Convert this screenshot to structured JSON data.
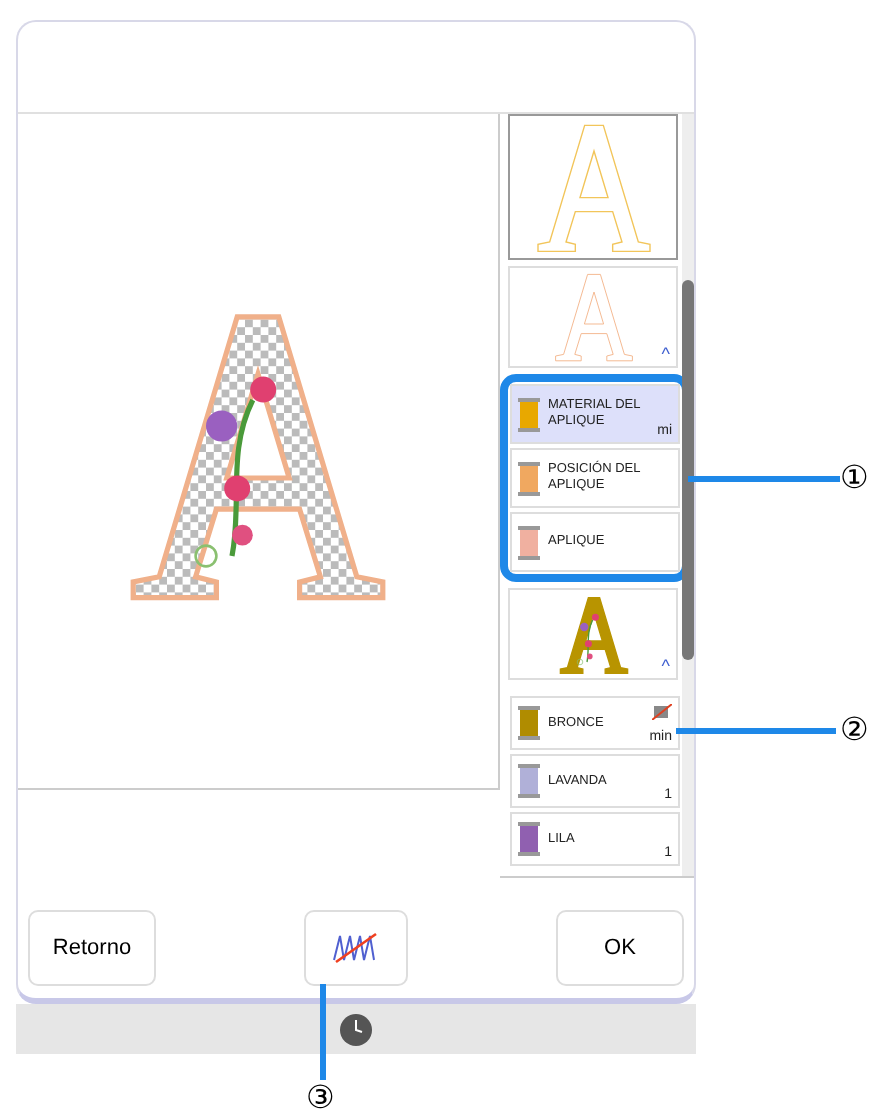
{
  "preview_list": [
    {
      "kind": "outline",
      "color": "#f2c55a",
      "selected": true
    },
    {
      "kind": "outline",
      "color": "#f4b78e",
      "selected": false,
      "caret": "^"
    },
    {
      "kind": "colors",
      "threads": [
        {
          "name": "MATERIAL DEL APLIQUE",
          "color": "#e8a800",
          "count": "mi",
          "selected": true,
          "skip": false
        },
        {
          "name": "POSICIÓN DEL APLIQUE",
          "color": "#f0a860",
          "selected": false,
          "skip": false
        },
        {
          "name": "APLIQUE",
          "color": "#f0b0a0",
          "selected": false,
          "skip": false
        }
      ]
    },
    {
      "kind": "stitched",
      "color": "#b89400",
      "selected": false,
      "caret": "^"
    },
    {
      "kind": "colors",
      "threads": [
        {
          "name": "BRONCE",
          "color": "#b08c00",
          "count": "min",
          "selected": false,
          "skip": true
        },
        {
          "name": "LAVANDA",
          "color": "#b0b0d8",
          "count": "1",
          "selected": false,
          "skip": false
        },
        {
          "name": "LILA",
          "color": "#9060b0",
          "count": "1",
          "selected": false,
          "skip": false
        }
      ]
    }
  ],
  "buttons": [
    {
      "kind": "text",
      "label": "Retorno"
    },
    {
      "kind": "stitch-skip"
    },
    {
      "kind": "text",
      "label": "OK"
    }
  ],
  "callouts": [
    "①",
    "②",
    "③"
  ]
}
